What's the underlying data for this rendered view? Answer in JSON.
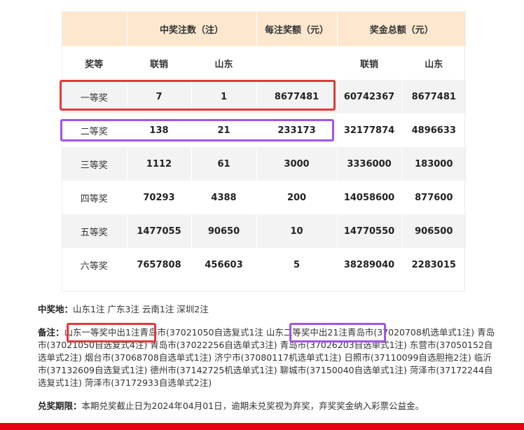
{
  "table": {
    "header": {
      "level": "奖等",
      "winners_group": "中奖注数（注）",
      "per_bet": "每注奖额（元）",
      "total_group": "奖金总额（元）",
      "national": "联销",
      "shandong": "山东"
    },
    "rows": [
      {
        "level": "一等奖",
        "win_national": "7",
        "win_shandong": "1",
        "per_bet": "8677481",
        "total_national": "60742367",
        "total_shandong": "8677481"
      },
      {
        "level": "二等奖",
        "win_national": "138",
        "win_shandong": "21",
        "per_bet": "233173",
        "total_national": "32177874",
        "total_shandong": "4896633"
      },
      {
        "level": "三等奖",
        "win_national": "1112",
        "win_shandong": "61",
        "per_bet": "3000",
        "total_national": "3336000",
        "total_shandong": "183000"
      },
      {
        "level": "四等奖",
        "win_national": "70293",
        "win_shandong": "4388",
        "per_bet": "200",
        "total_national": "14058600",
        "total_shandong": "877600"
      },
      {
        "level": "五等奖",
        "win_national": "1477055",
        "win_shandong": "90650",
        "per_bet": "10",
        "total_national": "14770550",
        "total_shandong": "906500"
      },
      {
        "level": "六等奖",
        "win_national": "7657808",
        "win_shandong": "456603",
        "per_bet": "5",
        "total_national": "38289040",
        "total_shandong": "2283015"
      }
    ]
  },
  "colors": {
    "header_bg": "#fde8cf",
    "highlight_red": "#e5373c",
    "highlight_purple": "#a155e6",
    "bottom_bar": "#e60012"
  },
  "winning_places": {
    "label": "中奖地：",
    "text": "山东1注 广东3注 云南1注 深圳2注"
  },
  "remarks": {
    "label": "备注：",
    "first_highlight": "山东一等奖中出1注",
    "first_detail": "青岛市(37021050自选复式1注",
    "second_highlight": "山东二等奖中出21注",
    "second_detail": "青岛市(37020708机选单式1注) 青岛市(37021050自选复式4注) 青岛市(37022256自选单式3注) 青岛市(37026203自选单式1注) 东营市(37050152自选单式2注) 烟台市(37068708自选单式1注) 济宁市(37080117机选单式1注) 日照市(37110099自选胆拖2注) 临沂市(37132609自选复式1注) 德州市(37142725机选单式1注) 聊城市(37150040自选单式1注) 菏泽市(37172244自选复式1注) 菏泽市(37172933自选单式2注)"
  },
  "deadline": {
    "label": "兑奖期限：",
    "text": "本期兑奖截止日为2024年04月01日，逾期未兑奖视为弃奖，弃奖奖金纳入彩票公益金。"
  }
}
